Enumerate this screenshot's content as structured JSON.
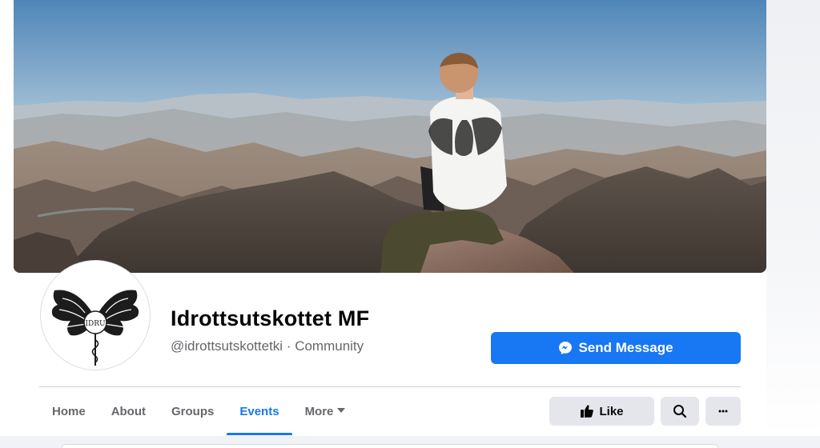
{
  "page": {
    "name": "Idrottsutskottet MF",
    "subtitle": "@idrottsutskottetki · Community",
    "avatar_text": "IDRU"
  },
  "actions": {
    "send_message": "Send Message",
    "like": "Like"
  },
  "tabs": [
    {
      "label": "Home",
      "active": false
    },
    {
      "label": "About",
      "active": false
    },
    {
      "label": "Groups",
      "active": false
    },
    {
      "label": "Events",
      "active": true
    },
    {
      "label": "More",
      "active": false
    }
  ],
  "icons": {
    "messenger": "messenger-icon",
    "like": "thumbs-up-icon",
    "search": "search-icon",
    "more": "ellipsis-icon",
    "more_tab": "caret-down-icon"
  },
  "colors": {
    "accent": "#1877f2",
    "secondary_button": "#e4e6eb",
    "text_primary": "#050505",
    "text_secondary": "#65676b"
  }
}
